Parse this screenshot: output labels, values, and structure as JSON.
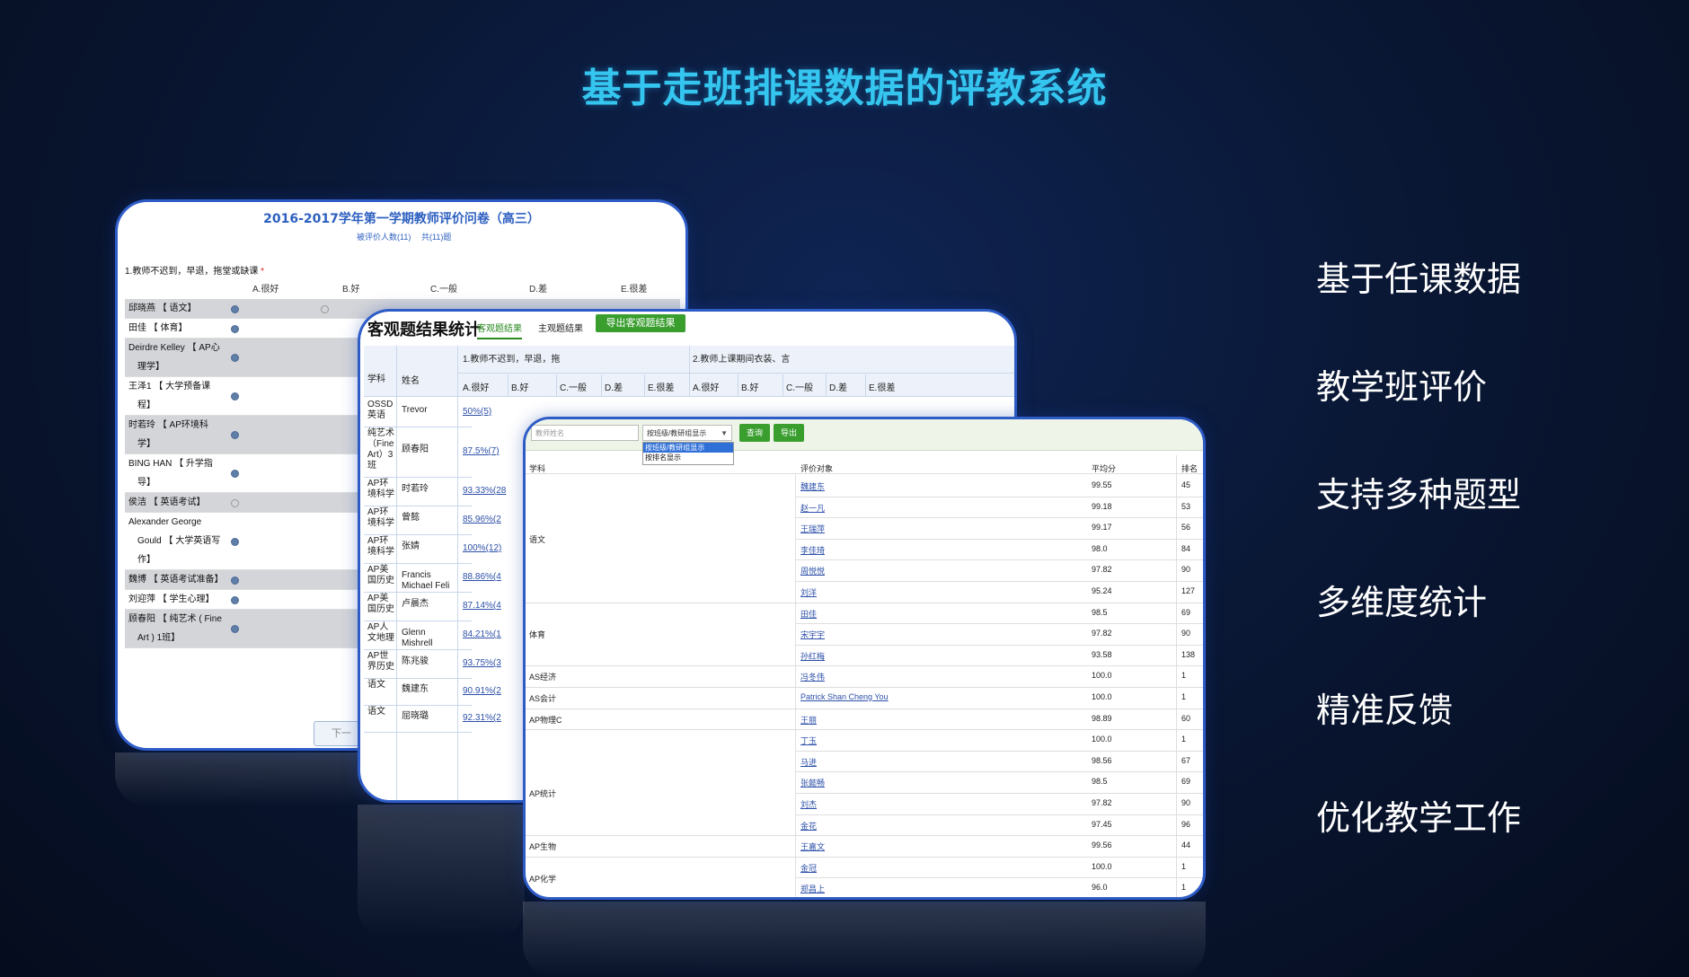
{
  "main_title": "基于走班排课数据的评教系统",
  "features": [
    "基于任课数据",
    "教学班评价",
    "支持多种题型",
    "多维度统计",
    "精准反馈",
    "优化教学工作"
  ],
  "questionnaire": {
    "title": "2016-2017学年第一学期教师评价问卷（高三）",
    "sub_left": "被评价人数(11)",
    "sub_right": "共(11)题",
    "question": "1.教师不迟到，早退，拖堂或缺课",
    "required_mark": "*",
    "options": [
      "A.很好",
      "B.好",
      "C.一般",
      "D.差",
      "E.很差"
    ],
    "rows": [
      {
        "name": "邱晓燕 【 语文】",
        "choice": 0,
        "gray": true
      },
      {
        "name": "田佳 【 体育】",
        "choice": 0,
        "gray": false
      },
      {
        "name": "Deirdre Kelley 【 AP心",
        "name2": "理学】",
        "choice": 0,
        "gray": true
      },
      {
        "name": "王泽1 【 大学预备课",
        "name2": "程】",
        "choice": 0,
        "gray": false
      },
      {
        "name": "时若玲 【 AP环境科",
        "name2": "学】",
        "choice": 0,
        "gray": true
      },
      {
        "name": "BING HAN 【 升学指",
        "name2": "导】",
        "choice": 0,
        "gray": false
      },
      {
        "name": "侯洁 【 英语考试】",
        "choice": -1,
        "gray": true
      },
      {
        "name": "Alexander George",
        "name2": "Gould 【 大学英语写",
        "name3": "作】",
        "choice": 0,
        "gray": false
      },
      {
        "name": "魏博 【 英语考试准备】",
        "choice": 0,
        "gray": true
      },
      {
        "name": "刘迎萍 【 学生心理】",
        "choice": 0,
        "gray": false
      },
      {
        "name": "顾春阳 【 纯艺术 ( Fine",
        "name2": "Art ) 1班】",
        "choice": 0,
        "gray": true
      }
    ],
    "next_button": "下一"
  },
  "stats": {
    "title": "客观题结果统计",
    "tab_objective": "客观题结果",
    "tab_subjective": "主观题结果",
    "export_button": "导出客观题结果",
    "col_subject": "学科",
    "col_name": "姓名",
    "q1_header": "1.教师不迟到，早退，拖",
    "q2_header": "2.教师上课期间衣装、言",
    "options": [
      "A.很好",
      "B.好",
      "C.一般",
      "D.差",
      "E.很差"
    ],
    "rows": [
      {
        "subject": [
          "OSSD",
          "英语"
        ],
        "name": "Trevor",
        "rate": "50%(5)"
      },
      {
        "subject": [
          "纯艺术",
          "（Fine",
          "Art）3",
          "班"
        ],
        "name": "顾春阳",
        "rate": "87.5%(7)"
      },
      {
        "subject": [
          "AP环",
          "境科学"
        ],
        "name": "时若玲",
        "rate": "93.33%(28"
      },
      {
        "subject": [
          "AP环",
          "境科学"
        ],
        "name": "曾懿",
        "rate": "85.96%(2"
      },
      {
        "subject": [
          "AP环",
          "境科学"
        ],
        "name": "张婧",
        "rate": "100%(12)"
      },
      {
        "subject": [
          "AP美",
          "国历史"
        ],
        "name": "Francis Michael Feli",
        "rate": "88.86%(4"
      },
      {
        "subject": [
          "AP美",
          "国历史"
        ],
        "name": "卢晨杰",
        "rate": "87.14%(4"
      },
      {
        "subject": [
          "AP人",
          "文地理"
        ],
        "name": "Glenn Mishrell",
        "rate": "84.21%(1"
      },
      {
        "subject": [
          "AP世",
          "界历史"
        ],
        "name": "陈兆骏",
        "rate": "93.75%(3"
      },
      {
        "subject": [
          "语文"
        ],
        "name": "魏建东",
        "rate": "90.91%(2"
      },
      {
        "subject": [
          "语文"
        ],
        "name": "屈晓璐",
        "rate": "92.31%(2"
      }
    ]
  },
  "ranking": {
    "search_placeholder": "教师姓名",
    "display_select": "按班级/教研组显示",
    "dropdown_options": [
      "按班级/教研组显示",
      "按排名显示"
    ],
    "query_button": "查询",
    "export_button": "导出",
    "col_subject": "学科",
    "col_target": "评价对象",
    "col_avg": "平均分",
    "col_rank": "排名",
    "rows": [
      {
        "name": "魏建东",
        "score": "99.55",
        "rank": "45"
      },
      {
        "name": "赵一凡",
        "score": "99.18",
        "rank": "53"
      },
      {
        "name": "王瑞萍",
        "score": "99.17",
        "rank": "56"
      },
      {
        "name": "李佳琦",
        "score": "98.0",
        "rank": "84"
      },
      {
        "name": "周悦悦",
        "score": "97.82",
        "rank": "90"
      },
      {
        "name": "刘洋",
        "score": "95.24",
        "rank": "127"
      },
      {
        "name": "田佳",
        "score": "98.5",
        "rank": "69"
      },
      {
        "name": "宋宇宇",
        "score": "97.82",
        "rank": "90"
      },
      {
        "name": "孙红梅",
        "score": "93.58",
        "rank": "138"
      },
      {
        "name": "冯冬伟",
        "score": "100.0",
        "rank": "1"
      },
      {
        "name": "Patrick Shan Cheng You",
        "score": "100.0",
        "rank": "1"
      },
      {
        "name": "王丽",
        "score": "98.89",
        "rank": "60"
      },
      {
        "name": "丁玉",
        "score": "100.0",
        "rank": "1"
      },
      {
        "name": "马进",
        "score": "98.56",
        "rank": "67"
      },
      {
        "name": "张懿畅",
        "score": "98.5",
        "rank": "69"
      },
      {
        "name": "刘杰",
        "score": "97.82",
        "rank": "90"
      },
      {
        "name": "金花",
        "score": "97.45",
        "rank": "96"
      },
      {
        "name": "王嘉文",
        "score": "99.56",
        "rank": "44"
      },
      {
        "name": "金冠",
        "score": "100.0",
        "rank": "1"
      },
      {
        "name": "郑昌上",
        "score": "96.0",
        "rank": "1"
      }
    ],
    "subjects": [
      {
        "label": "语文",
        "row": 2.5
      },
      {
        "label": "体育",
        "row": 7
      },
      {
        "label": "AS经济",
        "row": 9
      },
      {
        "label": "AS会计",
        "row": 10
      },
      {
        "label": "AP物理C",
        "row": 11
      },
      {
        "label": "AP统计",
        "row": 14.5
      },
      {
        "label": "AP生物",
        "row": 17
      },
      {
        "label": "AP化学",
        "row": 18.5
      }
    ]
  }
}
